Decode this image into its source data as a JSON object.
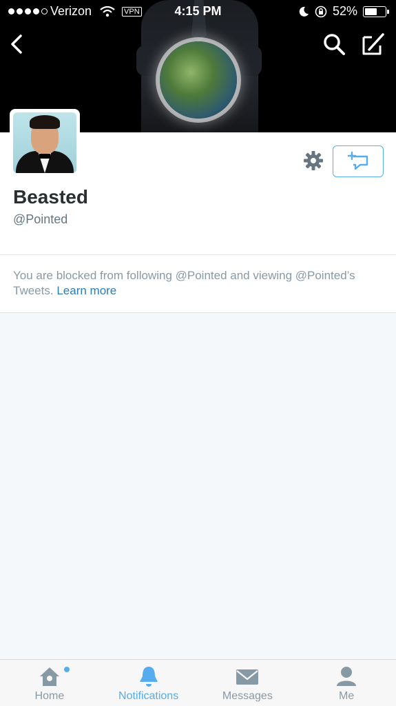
{
  "status_bar": {
    "carrier": "Verizon",
    "vpn": "VPN",
    "time": "4:15 PM",
    "battery_percent": "52%",
    "battery_level": 0.52,
    "signal_bars": 4
  },
  "profile": {
    "display_name": "Beasted",
    "handle": "@Pointed"
  },
  "blocked_notice": {
    "text": "You are blocked from following @Pointed and viewing @Pointed’s Tweets.",
    "link": "Learn more"
  },
  "tabs": [
    {
      "label": "Home",
      "icon": "home-icon",
      "active": false
    },
    {
      "label": "Notifications",
      "icon": "bell-icon",
      "active": true
    },
    {
      "label": "Messages",
      "icon": "envelope-icon",
      "active": false
    },
    {
      "label": "Me",
      "icon": "person-icon",
      "active": false
    }
  ],
  "colors": {
    "accent": "#55acee",
    "link": "#2b7bb9",
    "muted": "#8899a6",
    "text": "#292f33",
    "background": "#f5f8fa"
  }
}
